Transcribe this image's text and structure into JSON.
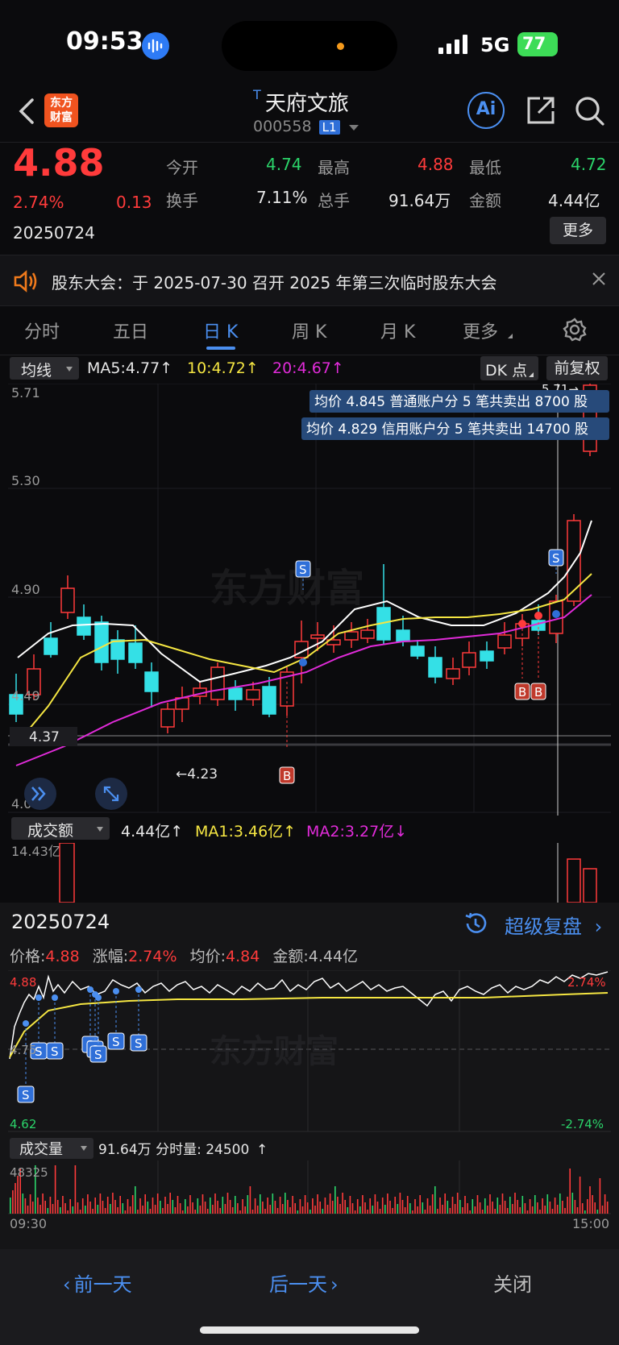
{
  "status_bar": {
    "time": "09:53",
    "network": "5G",
    "battery": "77"
  },
  "header": {
    "logo_line1": "东方",
    "logo_line2": "财富",
    "title_prefix": "T",
    "title": "天府文旅",
    "code": "000558",
    "level": "L1",
    "ai_label": "Ai"
  },
  "quote": {
    "price": "4.88",
    "change_pct": "2.74%",
    "change": "0.13",
    "date": "20250724",
    "open_label": "今开",
    "open": "4.74",
    "high_label": "最高",
    "high": "4.88",
    "low_label": "最低",
    "low": "4.72",
    "turnover_label": "换手",
    "turnover": "7.11%",
    "volume_label": "总手",
    "volume": "91.64万",
    "amount_label": "金额",
    "amount": "4.44亿",
    "more_button": "更多"
  },
  "notice": {
    "text": "股东大会：于 2025-07-30 召开 2025 年第三次临时股东大会"
  },
  "tabs": {
    "t1": "分时",
    "t2": "五日",
    "t3": "日 K",
    "t4": "周 K",
    "t5": "月 K",
    "t6": "更多",
    "active": "日 K"
  },
  "kline_toolbar": {
    "ma_select": "均线",
    "ma5": "MA5:4.77",
    "ma10": "10:4.72",
    "ma20": "20:4.67",
    "dk_button": "DK 点",
    "fq_button": "前复权"
  },
  "kline": {
    "y_labels": [
      "5.71",
      "5.30",
      "4.90",
      "4.49",
      "4.08"
    ],
    "current_line_label": "4.37",
    "min_label": "←4.23",
    "max_label": "5.71→",
    "trade_note_1": "均价 4.845 普通账户分 5 笔共卖出 8700 股",
    "trade_note_2": "均价 4.829 信用账户分 5 笔共卖出 14700 股",
    "watermark": "东方财富",
    "marker_s": "S",
    "marker_b": "B"
  },
  "volume_toolbar": {
    "select": "成交额",
    "value": "4.44亿",
    "ma1": "MA1:3.46亿",
    "ma2": "MA2:3.27亿",
    "top_label": "14.43亿"
  },
  "intraday": {
    "date": "20250724",
    "replay_label": "超级复盘",
    "price_label": "价格:",
    "price": "4.88",
    "chg_label": "涨幅:",
    "chg": "2.74%",
    "avg_label": "均价:",
    "avg": "4.84",
    "amount_label": "金额:4.44亿",
    "y_top": "4.88",
    "y_mid": "4.75",
    "y_bottom": "4.62",
    "pct_top": "2.74%",
    "pct_bottom": "-2.74%",
    "vol_select": "成交量",
    "vol_value": "91.64万 分时量: 24500",
    "vol_top": "48325",
    "time_start": "09:30",
    "time_end": "15:00",
    "watermark": "东方财富"
  },
  "bottom_nav": {
    "prev": "前一天",
    "next": "后一天",
    "close": "关闭"
  },
  "colors": {
    "up": "#ff3b3b",
    "down": "#2bd46a",
    "ma5": "#ffffff",
    "ma10": "#f5e642",
    "ma20": "#e12bd9",
    "accent": "#4b8ff0"
  }
}
